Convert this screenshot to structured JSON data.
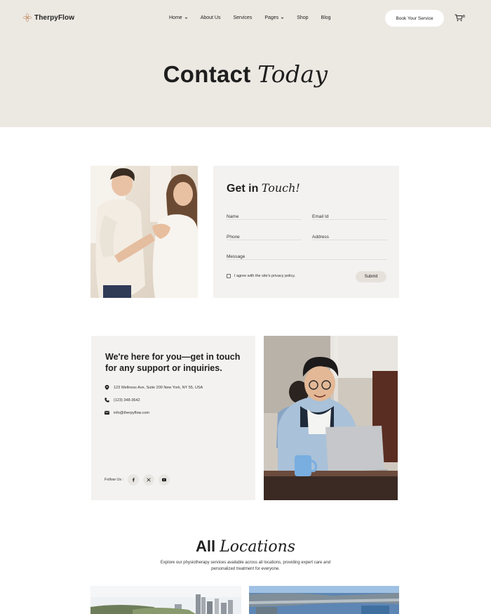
{
  "header": {
    "brand": "TherpyFlow",
    "nav": [
      {
        "label": "Home",
        "has_dropdown": true
      },
      {
        "label": "About Us",
        "has_dropdown": false
      },
      {
        "label": "Services",
        "has_dropdown": false
      },
      {
        "label": "Pages",
        "has_dropdown": true
      },
      {
        "label": "Shop",
        "has_dropdown": false
      },
      {
        "label": "Blog",
        "has_dropdown": false
      }
    ],
    "cta_label": "Book Your Service",
    "cart_count": "0",
    "cart_icon": "cart-icon"
  },
  "hero": {
    "title_plain": "Contact",
    "title_script": "Today"
  },
  "contact_form": {
    "title_plain": "Get in",
    "title_script": "Touch!",
    "fields": {
      "name": {
        "placeholder": "Name",
        "value": ""
      },
      "email": {
        "placeholder": "Email Id",
        "value": ""
      },
      "phone": {
        "placeholder": "Phone",
        "value": ""
      },
      "address": {
        "placeholder": "Address",
        "value": ""
      },
      "message": {
        "placeholder": "Message",
        "value": ""
      }
    },
    "agree_label": "I agree with the site's privacy policy.",
    "agree_checked": false,
    "submit_label": "Submit"
  },
  "info": {
    "heading": "We're here for you—get in touch for any support or inquiries.",
    "address": "123 Wellness Ave, Suite 200 New York, NY 55, USA",
    "phone": "(123) 348-3642",
    "email": "info@therpyflow.com",
    "follow_label": "Follow Us :",
    "socials": [
      "facebook-icon",
      "x-icon",
      "youtube-icon"
    ]
  },
  "locations": {
    "title_plain": "All",
    "title_script": "Locations",
    "description": "Explore our physiotherapy services available across all locations, providing expert care and personalized treatment for everyone."
  },
  "colors": {
    "hero_bg": "#ece8e2",
    "card_bg": "#f3f2f0",
    "text": "#1e1e1e",
    "brand_accent": "#c9a27e"
  }
}
